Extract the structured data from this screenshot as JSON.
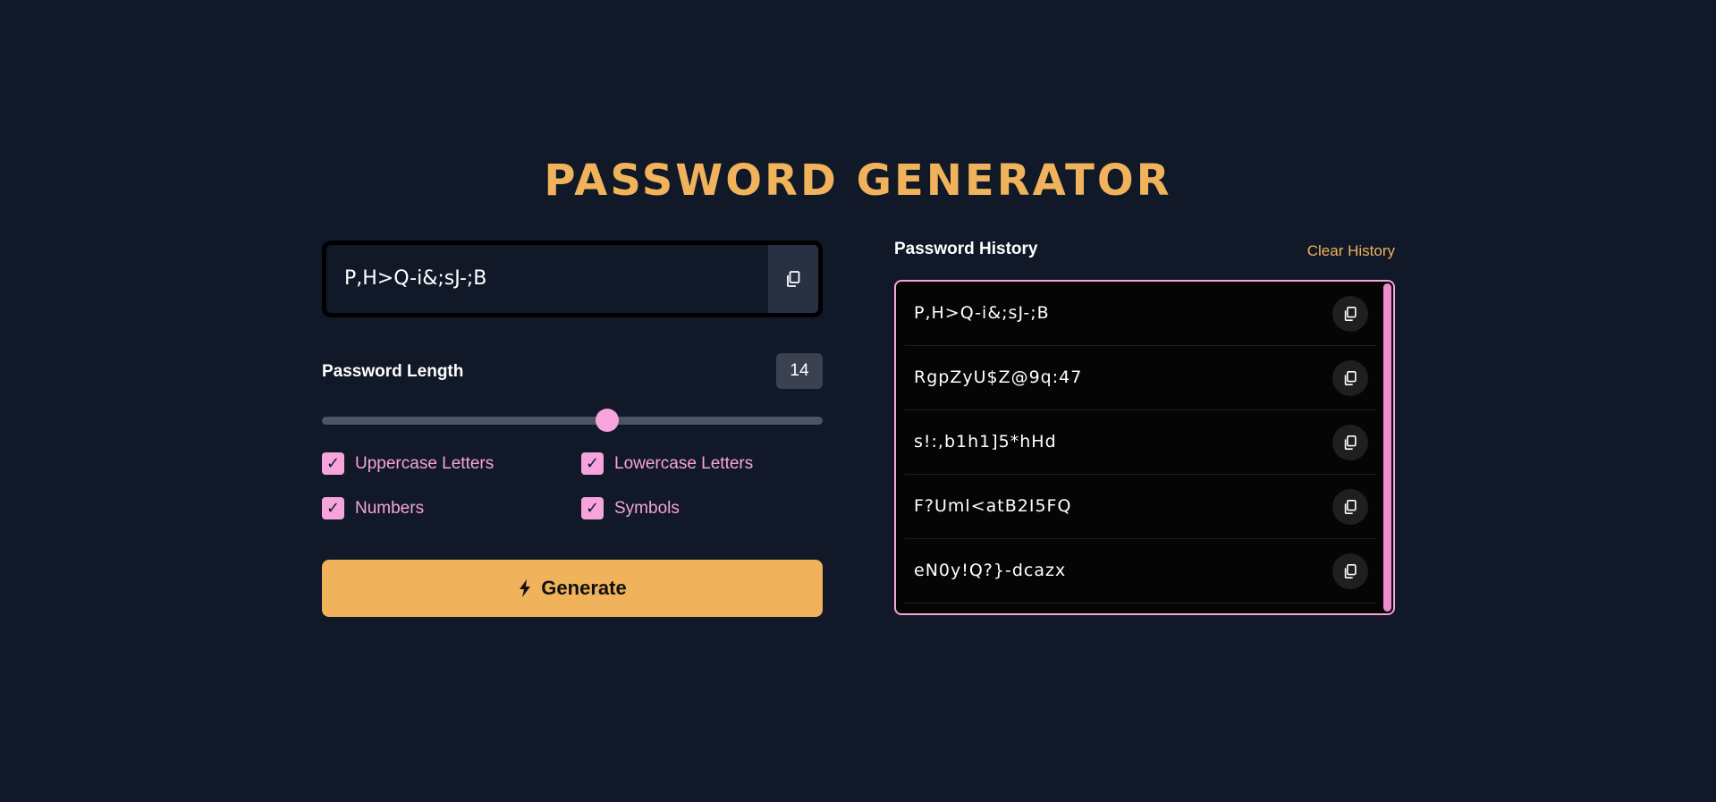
{
  "title": "PASSWORD GENERATOR",
  "generator": {
    "password": "P,H>Q-i&;sJ-;B",
    "copy_icon": "copy-icon",
    "length_label": "Password Length",
    "length_value": "14",
    "slider_fraction": 0.57,
    "options": [
      {
        "label": "Uppercase Letters",
        "checked": true
      },
      {
        "label": "Lowercase Letters",
        "checked": true
      },
      {
        "label": "Numbers",
        "checked": true
      },
      {
        "label": "Symbols",
        "checked": true
      }
    ],
    "checkmark": "✓",
    "generate_label": "Generate",
    "generate_icon": "lightning-bolt-icon"
  },
  "history": {
    "title": "Password History",
    "clear_label": "Clear History",
    "items": [
      "P,H>Q-i&;sJ-;B",
      "RgpZyU$Z@9q:47",
      "s!:,b1h1]5*hHd",
      "F?Uml<atB2I5FQ",
      "eN0y!Q?}-dcazx"
    ]
  },
  "colors": {
    "background": "#111827",
    "accent_orange": "#f0b35b",
    "accent_pink": "#f7a3dc"
  }
}
